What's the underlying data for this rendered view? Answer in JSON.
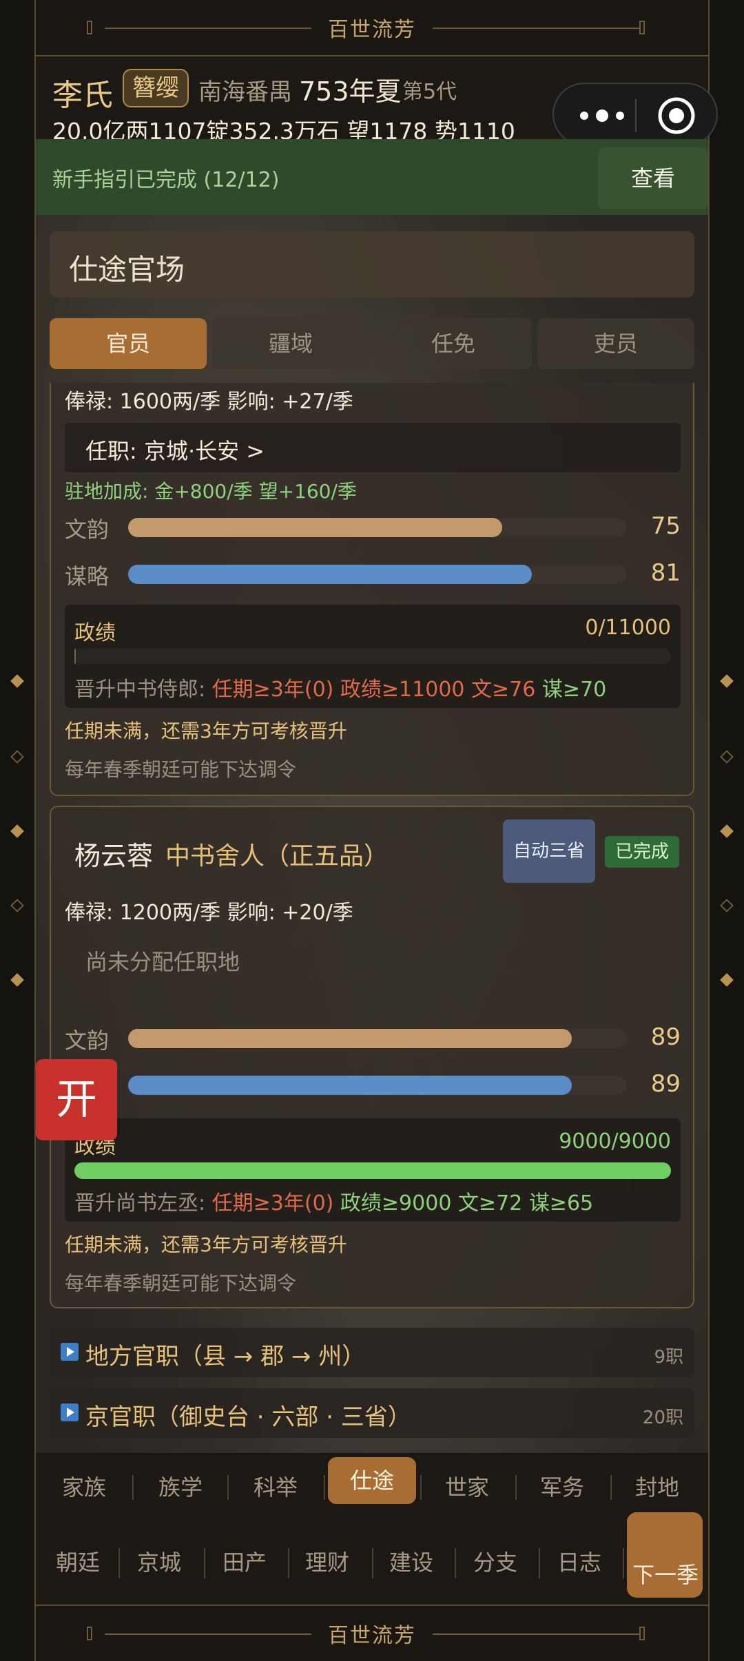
{
  "banner_title": "百世流芳",
  "header": {
    "clan": "李氏",
    "title_badge": "簪缨",
    "location": "南海番禺",
    "date": "753年夏",
    "generation": "第5代",
    "resources": "20.0亿两1107锭352.3万石  望1178  势1110"
  },
  "guide": {
    "text": "新手指引已完成 (12/12)",
    "button": "查看"
  },
  "section_title": "仕途官场",
  "tabs": [
    "官员",
    "疆域",
    "任免",
    "吏员"
  ],
  "card1": {
    "salary": "俸禄: 1600两/季   影响: +27/季",
    "post": "任职: 京城·长安  >",
    "bonus": "驻地加成: 金+800/季  望+160/季",
    "wenyun_label": "文韵",
    "wenyun": 75,
    "moulue_label": "谋略",
    "moulue": 81,
    "zhengji_label": "政绩",
    "zhengji_text": "0/11000",
    "zhengji_progress": 0,
    "promote_prefix": "晋升中书侍郎:",
    "req_term": "任期≥3年(0)",
    "req_merit": "政绩≥11000",
    "req_wen": "文≥76",
    "req_mou": "谋≥70",
    "note": "任期未满，还需3年方可考核晋升",
    "note2": "每年春季朝廷可能下达调令"
  },
  "card2": {
    "name": "杨云蓉",
    "rank": "中书舍人（正五品）",
    "auto_btn": "自动三省",
    "status": "已完成",
    "salary": "俸禄: 1200两/季   影响: +20/季",
    "post": "尚未分配任职地",
    "wenyun_label": "文韵",
    "wenyun": 89,
    "moulue": 89,
    "zhengji_label": "政绩",
    "zhengji_text": "9000/9000",
    "zhengji_progress": 1,
    "promote_prefix": "晋升尚书左丞:",
    "req_term": "任期≥3年(0)",
    "req_merit": "政绩≥9000",
    "req_wen": "文≥72",
    "req_mou": "谋≥65",
    "note": "任期未满，还需3年方可考核晋升",
    "note2": "每年春季朝廷可能下达调令"
  },
  "sub_sections": [
    {
      "label": "地方官职（县 → 郡 → 州）",
      "count": "9职"
    },
    {
      "label": "京官职（御史台 · 六部 · 三省）",
      "count": "20职"
    }
  ],
  "float_button": "开",
  "nav_primary": [
    "家族",
    "族学",
    "科举",
    "仕途",
    "世家",
    "军务",
    "封地"
  ],
  "nav_primary_active": 3,
  "nav_secondary": [
    "朝廷",
    "京城",
    "田产",
    "理财",
    "建设",
    "分支",
    "日志"
  ],
  "next_button": "下一季",
  "colors": {
    "accent": "#a86d32",
    "green": "#8fd27e",
    "red": "#e06a4a",
    "wen_bar": "#c29a6c",
    "mou_bar": "#5b8ec8"
  }
}
